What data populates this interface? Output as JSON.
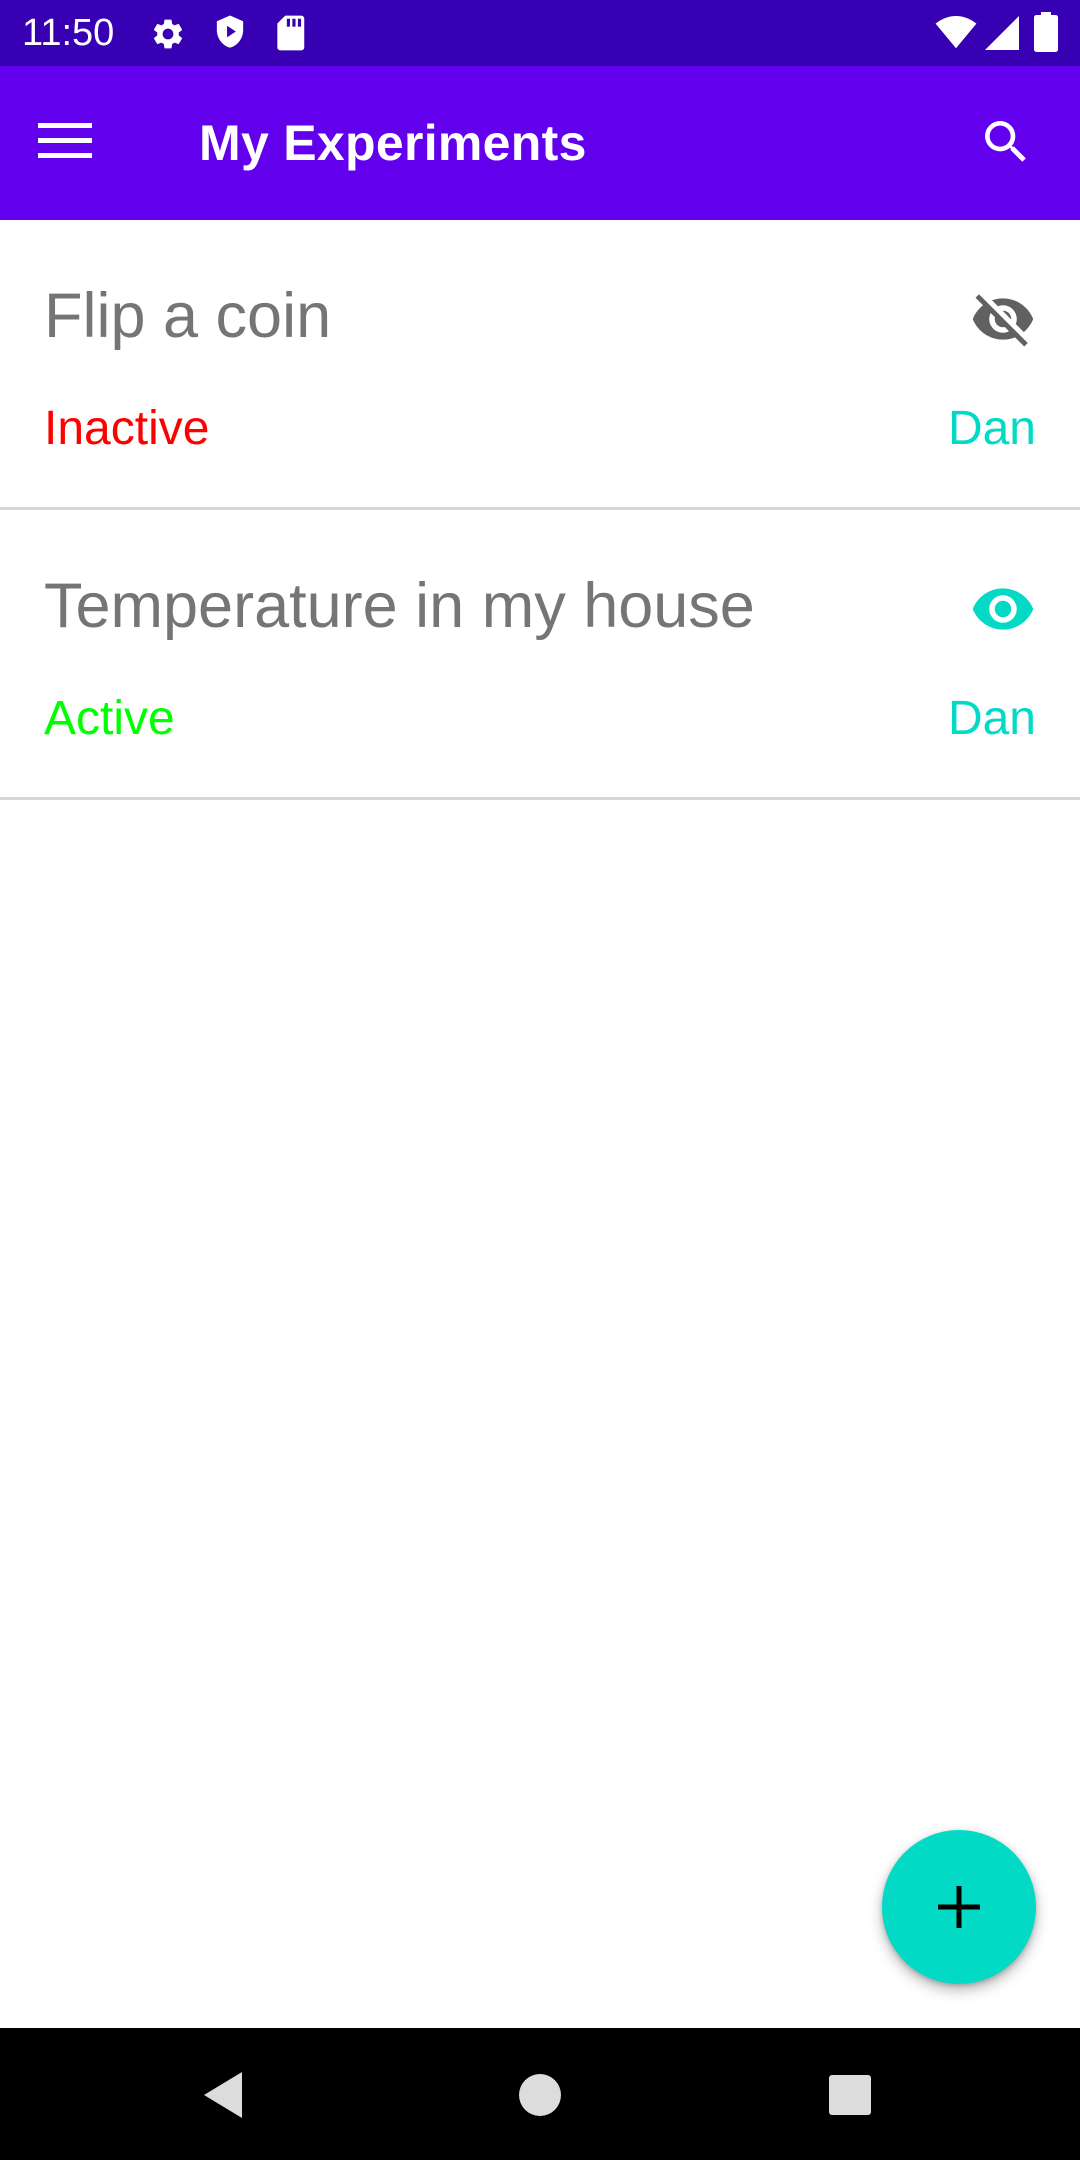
{
  "status_bar": {
    "time": "11:50",
    "left_icons": [
      "gear-icon",
      "shield-play-icon",
      "sd-card-icon"
    ],
    "right_icons": [
      "wifi-icon",
      "cell-signal-icon",
      "battery-icon"
    ]
  },
  "app_bar": {
    "title": "My Experiments",
    "menu_icon": "hamburger-menu-icon",
    "search_icon": "search-icon"
  },
  "experiments": [
    {
      "title": "Flip a coin",
      "status": "Inactive",
      "owner": "Dan",
      "visibility_icon": "eye-off-icon"
    },
    {
      "title": "Temperature in my house",
      "status": "Active",
      "owner": "Dan",
      "visibility_icon": "eye-icon"
    }
  ],
  "fab": {
    "icon": "plus-icon"
  },
  "nav_bar": {
    "icons": [
      "back-icon",
      "home-icon",
      "recents-icon"
    ]
  },
  "colors": {
    "status_bar": "#3700b3",
    "app_bar": "#6200ee",
    "accent": "#03dac5",
    "inactive": "#ff0000",
    "active": "#00ff00",
    "title_gray": "#757575",
    "hidden_icon": "#616161"
  }
}
